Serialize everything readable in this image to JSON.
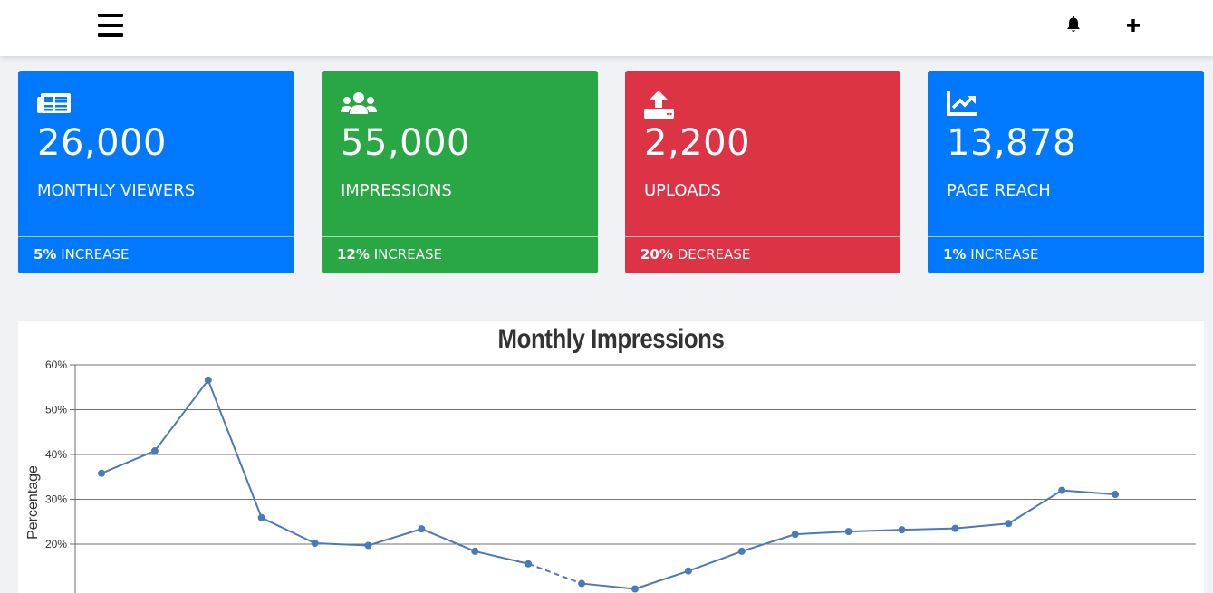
{
  "topbar": {
    "menu_icon": "hamburger-menu-icon",
    "bell_icon": "bell-icon",
    "plus_icon": "plus-icon"
  },
  "cards": [
    {
      "icon": "newspaper-icon",
      "value": "26,000",
      "label": "MONTHLY VIEWERS",
      "change": "5%",
      "change_word": "INCREASE",
      "color": "#0079fe"
    },
    {
      "icon": "users-icon",
      "value": "55,000",
      "label": "IMPRESSIONS",
      "change": "12%",
      "change_word": "INCREASE",
      "color": "#28a744"
    },
    {
      "icon": "upload-icon",
      "value": "2,200",
      "label": "UPLOADS",
      "change": "20%",
      "change_word": "DECREASE",
      "color": "#dc3445"
    },
    {
      "icon": "chart-line-icon",
      "value": "13,878",
      "label": "PAGE REACH",
      "change": "1%",
      "change_word": "INCREASE",
      "color": "#0079fe"
    }
  ],
  "chart_data": {
    "type": "line",
    "title": "Monthly Impressions",
    "ylabel": "Percentage",
    "xlabel": "",
    "ylim": [
      10,
      60
    ],
    "y_ticks": [
      "20%",
      "30%",
      "40%",
      "50%",
      "60%"
    ],
    "grid": true,
    "series": [
      {
        "color": "#4a7ab7",
        "values": [
          35.8,
          40.8,
          56.6,
          25.9,
          20.2,
          19.7,
          23.4,
          18.4,
          15.6,
          11.2,
          10.0,
          14.0,
          18.4,
          22.2,
          22.8,
          23.2,
          23.5,
          24.6,
          32.0,
          31.1
        ]
      }
    ],
    "dashed_segments": [
      [
        8,
        9
      ]
    ]
  }
}
